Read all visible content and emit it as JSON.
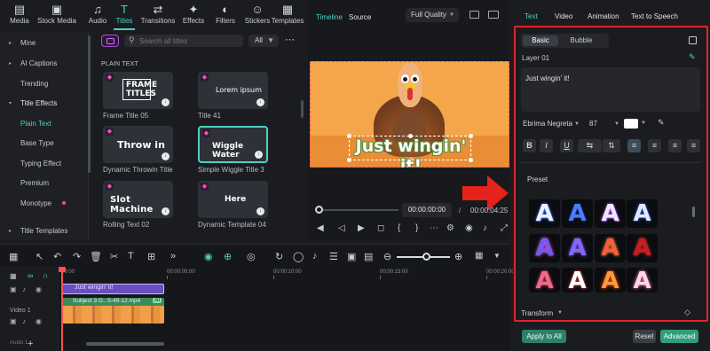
{
  "media_tabs": [
    {
      "label": "Media",
      "icon": "media-icon"
    },
    {
      "label": "Stock Media",
      "icon": "stock-media-icon"
    },
    {
      "label": "Audio",
      "icon": "audio-icon"
    },
    {
      "label": "Titles",
      "icon": "titles-icon"
    },
    {
      "label": "Transitions",
      "icon": "transitions-icon"
    },
    {
      "label": "Effects",
      "icon": "effects-icon"
    },
    {
      "label": "Filters",
      "icon": "filters-icon"
    },
    {
      "label": "Stickers",
      "icon": "stickers-icon"
    },
    {
      "label": "Templates",
      "icon": "templates-icon"
    }
  ],
  "sidebar": [
    {
      "label": "Mine",
      "caret": "▸"
    },
    {
      "label": "AI Captions",
      "caret": "▸"
    },
    {
      "label": "Trending",
      "caret": ""
    },
    {
      "label": "Title Effects",
      "caret": "▾"
    },
    {
      "label": "Plain Text",
      "caret": ""
    },
    {
      "label": "Base Type",
      "caret": ""
    },
    {
      "label": "Typing Effect",
      "caret": ""
    },
    {
      "label": "Premium",
      "caret": ""
    },
    {
      "label": "Monotype",
      "caret": ""
    },
    {
      "label": "Title Templates",
      "caret": "▸"
    }
  ],
  "browser": {
    "search_placeholder": "Search all titles",
    "filter_label": "All",
    "section_label": "PLAIN TEXT",
    "cards": [
      {
        "preview": "FRAME TITLES",
        "caption": "Frame Title 05"
      },
      {
        "preview": "Lorem ipsum",
        "caption": "Title 41"
      },
      {
        "preview": "Throw in",
        "caption": "Dynamic Throwin Title"
      },
      {
        "preview": "Wiggle Water",
        "caption": "Simple Wiggle Title 3"
      },
      {
        "preview": "Slot Machine",
        "caption": "Rolling Text 02"
      },
      {
        "preview": "Here",
        "caption": "Dynamic Template 04"
      }
    ]
  },
  "player": {
    "tab_timeline": "Timeline",
    "tab_source": "Source",
    "quality": "Full Quality",
    "overlay_text": "Just wingin' it!",
    "current_time": "00:00:00:00",
    "separator": "/",
    "total_time": "00:00:04:25",
    "colors": {
      "video_bg": "#f5a54a",
      "selection": "#ff5a5a",
      "arrow": "#e5231c"
    }
  },
  "timeline": {
    "ruler": [
      "00:00",
      "00:00:05:00",
      "00:00:10:00",
      "00:00:15:00",
      "00:00:20:00"
    ],
    "title_clip": "Just wingin' it!",
    "video_clip": "Subject 3 G...5-49-12.mp4",
    "ai_badge": "AI",
    "video_track": "Video 1",
    "audio_track": "Audio 1"
  },
  "properties": {
    "tabs": [
      "Text",
      "Video",
      "Animation",
      "Text to Speech"
    ],
    "subtabs": [
      "Basic",
      "Bubble"
    ],
    "layer": "Layer 01",
    "text_value": "Just wingin' it!",
    "font": "Ebrima Negreta",
    "size": "87",
    "preset_label": "Preset",
    "transform_label": "Transform",
    "apply_all": "Apply to All",
    "reset": "Reset",
    "advanced": "Advanced",
    "colors": {
      "accent": "#4fd1c5",
      "highlight": "#e5232d"
    }
  }
}
